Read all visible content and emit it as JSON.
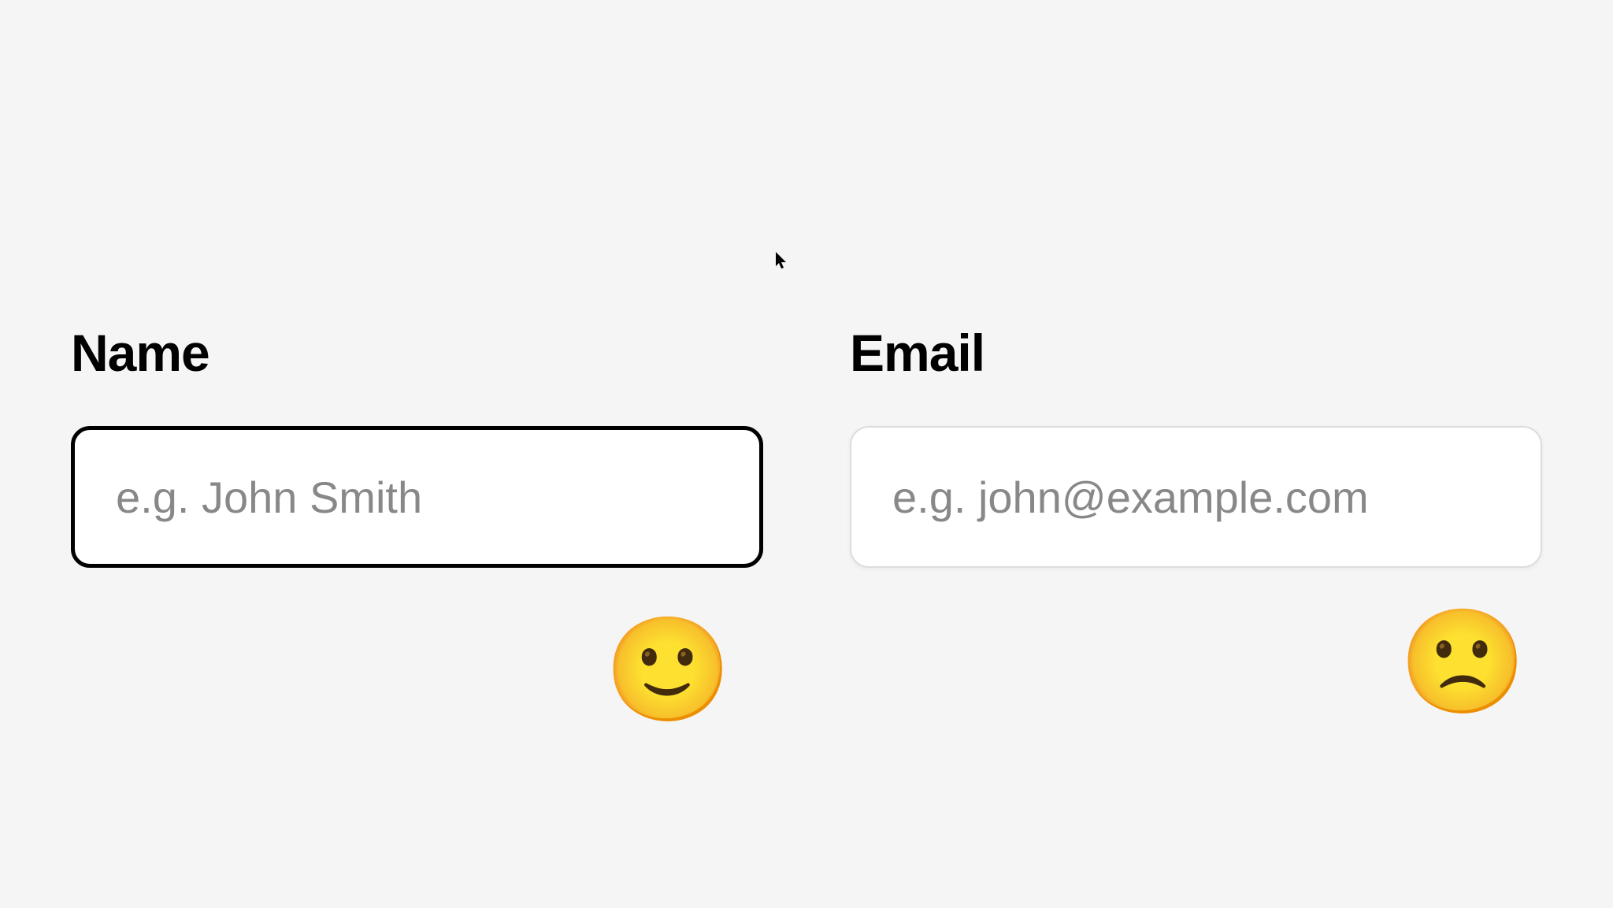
{
  "form": {
    "name": {
      "label": "Name",
      "placeholder": "e.g. John Smith",
      "value": ""
    },
    "email": {
      "label": "Email",
      "placeholder": "e.g. john@example.com",
      "value": ""
    }
  },
  "icons": {
    "happy": "🙂",
    "sad": "🙁"
  }
}
